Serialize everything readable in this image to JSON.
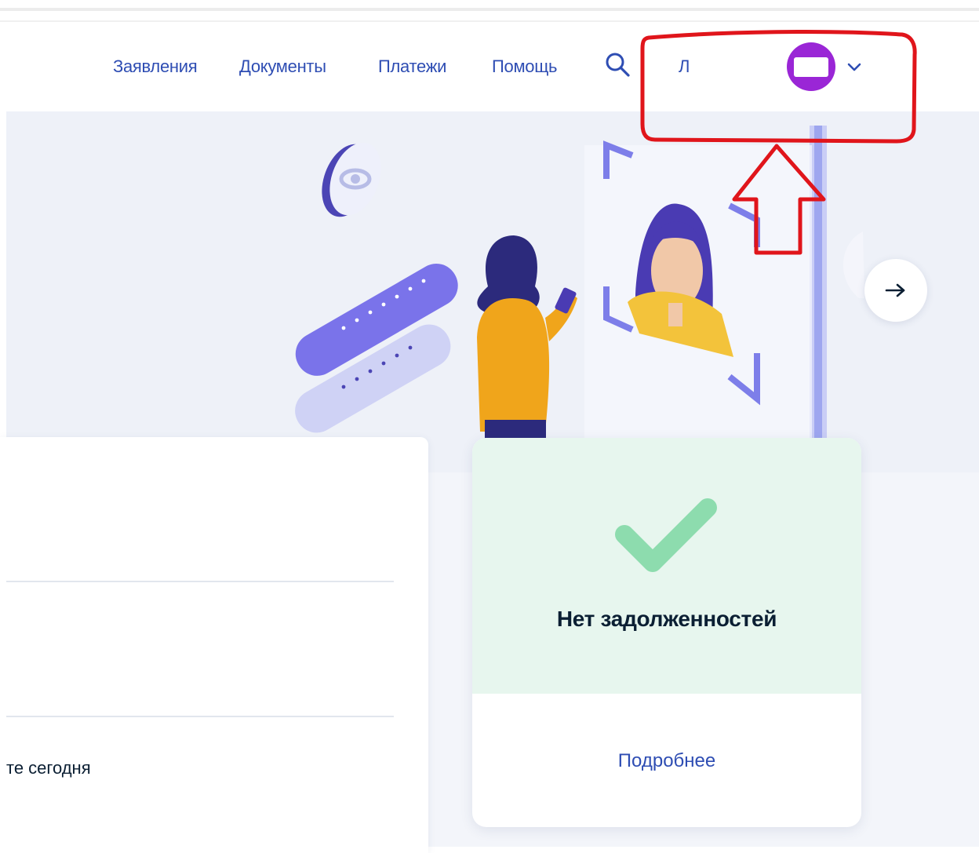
{
  "header": {
    "nav": [
      {
        "label": "Заявления"
      },
      {
        "label": "Документы"
      },
      {
        "label": "Платежи"
      },
      {
        "label": "Помощь"
      }
    ],
    "search_icon": "search-icon",
    "user_initial": "Л",
    "avatar_icon": "avatar",
    "menu_icon": "chevron-down-icon"
  },
  "banner": {
    "next_icon": "arrow-right-icon"
  },
  "left_card": {
    "text": "те сегодня"
  },
  "debt_card": {
    "icon": "check-icon",
    "title": "Нет задолженностей",
    "link": "Подробнее"
  },
  "colors": {
    "link": "#2e4db3",
    "annotation": "#e0151b",
    "success": "#8ddcae",
    "avatar": "#9a26d6"
  }
}
